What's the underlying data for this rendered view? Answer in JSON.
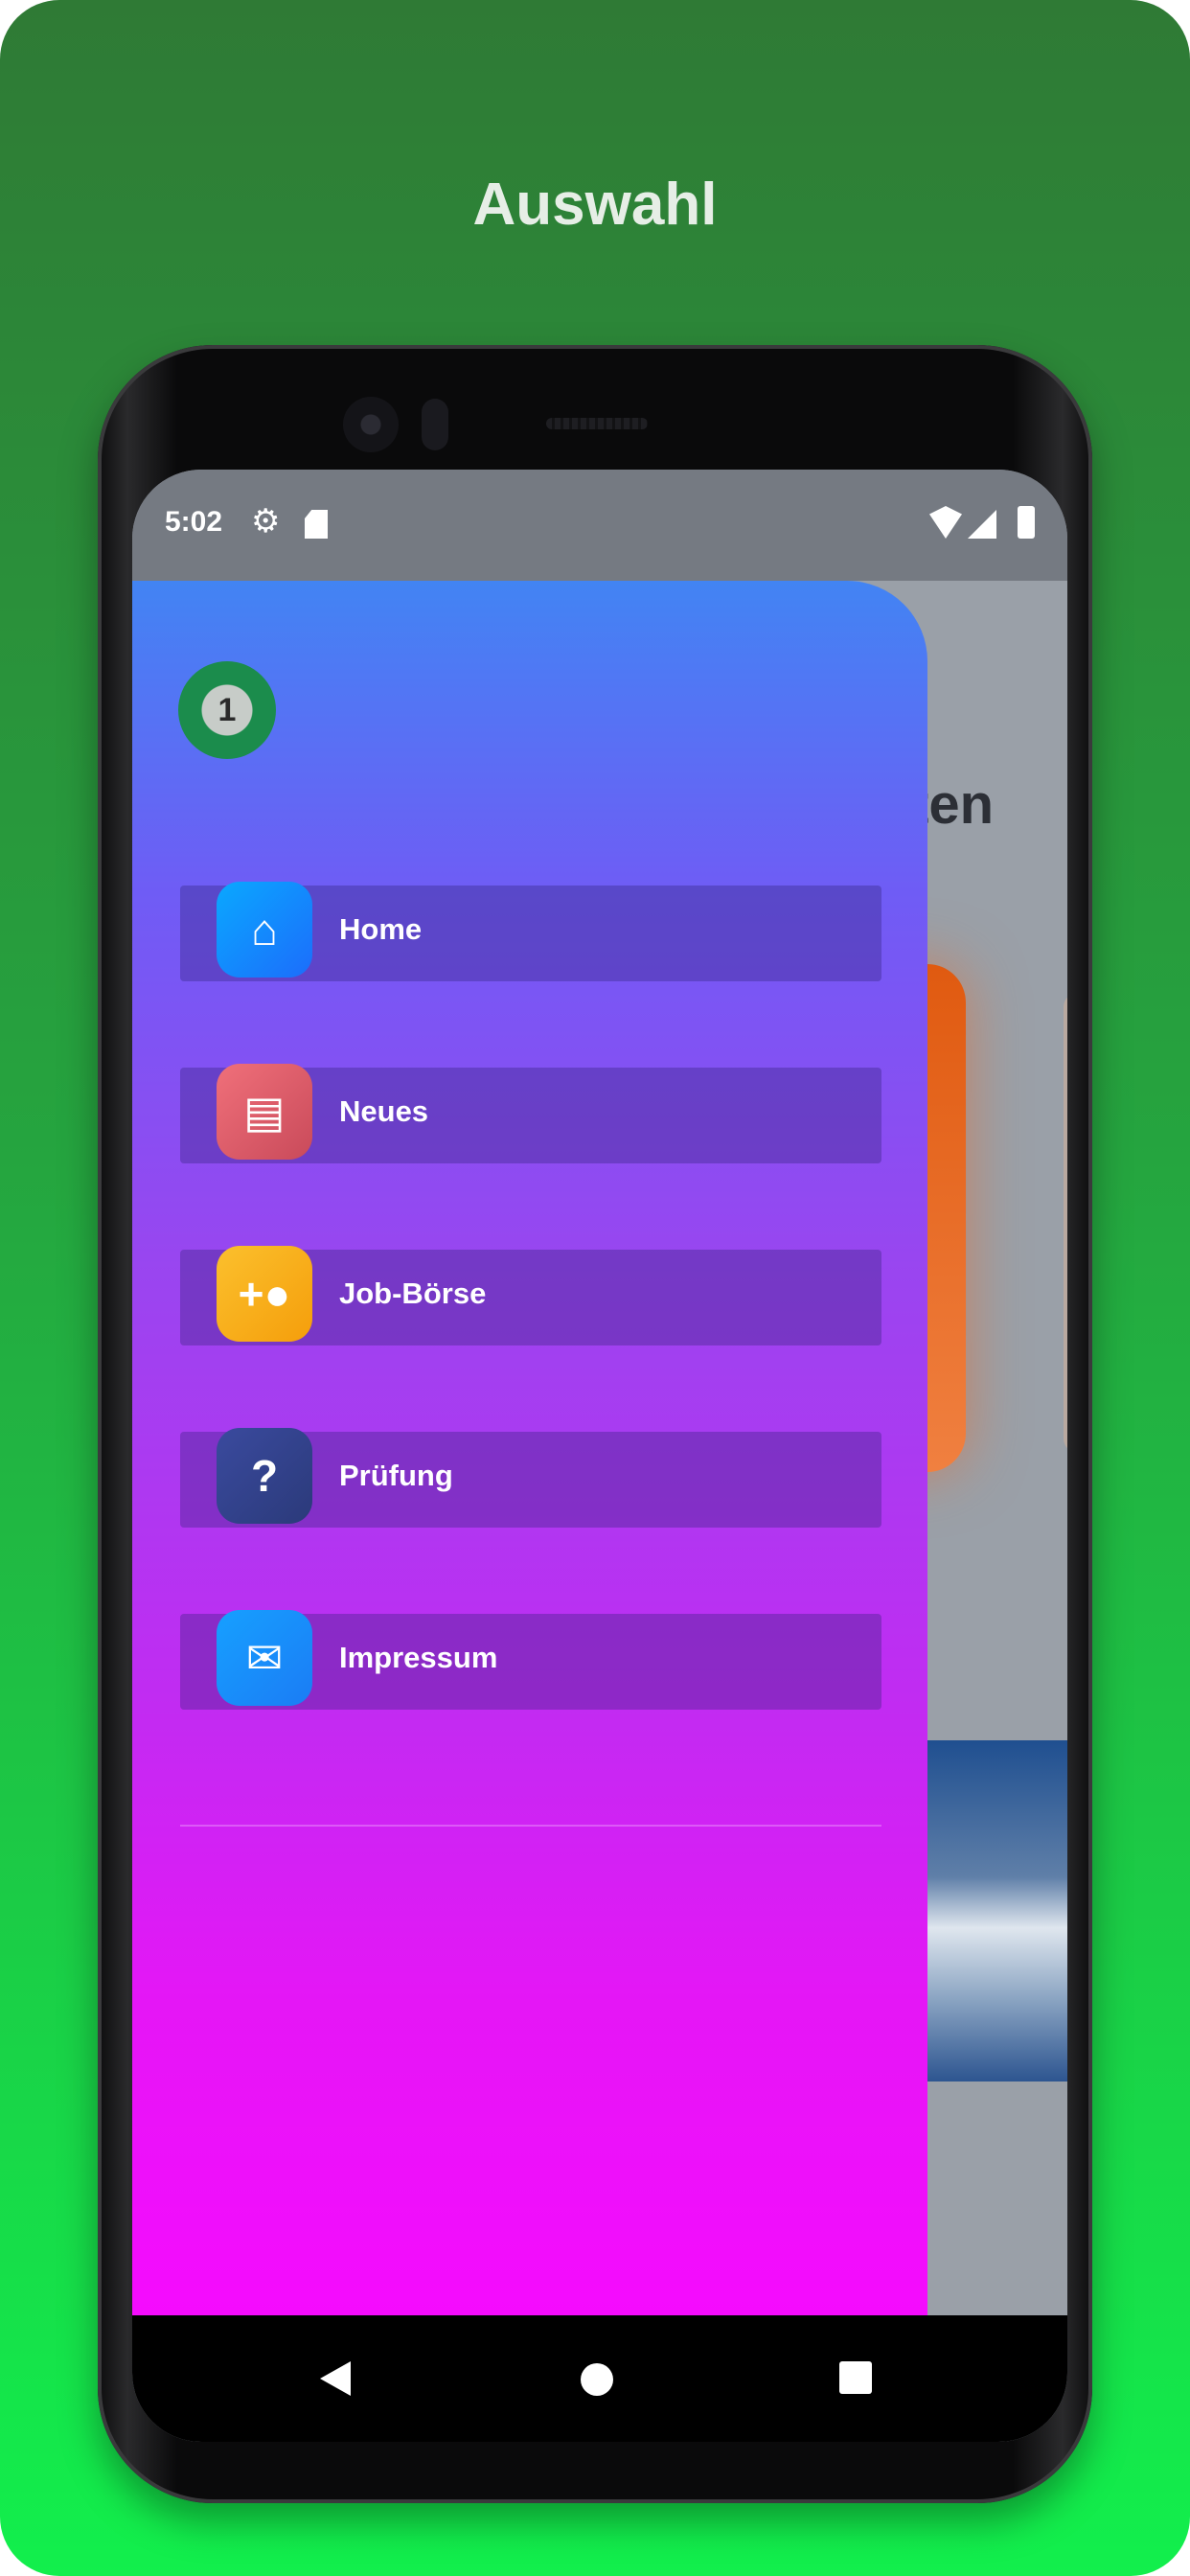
{
  "headline": "Auswahl",
  "status_bar": {
    "time": "5:02",
    "icons": [
      "gear-icon",
      "sd-card-icon",
      "wifi-icon",
      "signal-icon",
      "battery-icon"
    ]
  },
  "background_app": {
    "title_fragment": "ten"
  },
  "drawer": {
    "avatar_glyph": "1",
    "items": [
      {
        "label": "Home",
        "icon": "home-icon"
      },
      {
        "label": "Neues",
        "icon": "newspaper-icon"
      },
      {
        "label": "Job-Börse",
        "icon": "person-add-icon"
      },
      {
        "label": "Prüfung",
        "icon": "help-icon"
      },
      {
        "label": "Impressum",
        "icon": "mail-icon"
      }
    ]
  },
  "colors": {
    "frame_top": "#2f7a35",
    "frame_bottom": "#12ef4c",
    "drawer_top": "#4284f3",
    "drawer_bottom": "#f50bfe"
  }
}
